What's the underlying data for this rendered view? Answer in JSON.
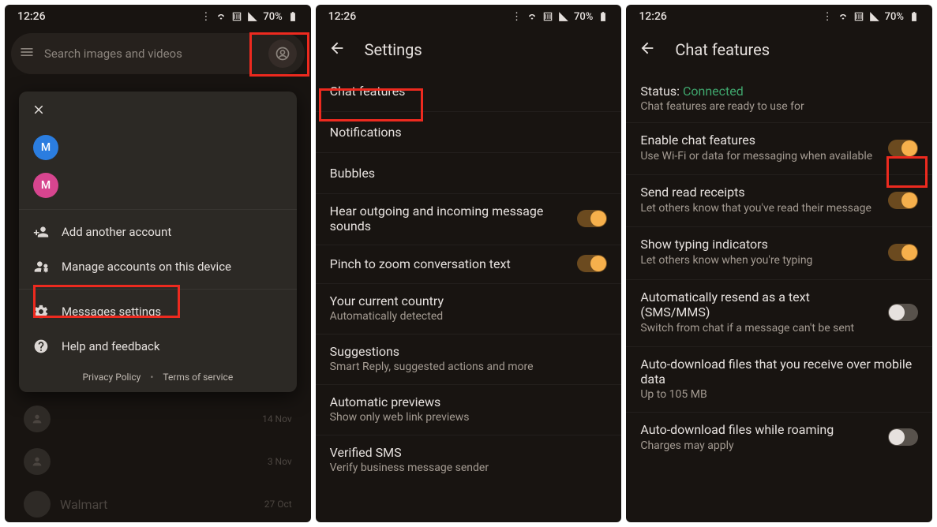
{
  "statusbar": {
    "time": "12:26",
    "battery": "70%"
  },
  "phone1": {
    "search_placeholder": "Search images and videos",
    "accounts": [
      {
        "letter": "M",
        "color": "#2b7de0"
      },
      {
        "letter": "M",
        "color": "#d7458f"
      }
    ],
    "menu": {
      "add_account": "Add another account",
      "manage_accounts": "Manage accounts on this device",
      "messages_settings": "Messages settings",
      "help_feedback": "Help and feedback"
    },
    "legal": {
      "privacy": "Privacy Policy",
      "terms": "Terms of service"
    },
    "bg_chats": [
      {
        "date": "14 Nov"
      },
      {
        "date": "3 Nov"
      },
      {
        "name": "Walmart",
        "date": "27 Oct"
      }
    ]
  },
  "phone2": {
    "title": "Settings",
    "items": [
      {
        "primary": "Chat features"
      },
      {
        "primary": "Notifications"
      },
      {
        "primary": "Bubbles"
      },
      {
        "primary": "Hear outgoing and incoming message sounds",
        "toggle": "on"
      },
      {
        "primary": "Pinch to zoom conversation text",
        "toggle": "on"
      },
      {
        "primary": "Your current country",
        "secondary": "Automatically detected"
      },
      {
        "primary": "Suggestions",
        "secondary": "Smart Reply, suggested actions and more"
      },
      {
        "primary": "Automatic previews",
        "secondary": "Show only web link previews"
      },
      {
        "primary": "Verified SMS",
        "secondary": "Verify business message sender"
      }
    ]
  },
  "phone3": {
    "title": "Chat features",
    "status_label": "Status: ",
    "status_value": "Connected",
    "status_sub": "Chat features are ready to use for",
    "items": [
      {
        "primary": "Enable chat features",
        "secondary": "Use Wi-Fi or data for messaging when available",
        "toggle": "on"
      },
      {
        "primary": "Send read receipts",
        "secondary": "Let others know that you've read their message",
        "toggle": "on"
      },
      {
        "primary": "Show typing indicators",
        "secondary": "Let others know when you're typing",
        "toggle": "on"
      },
      {
        "primary": "Automatically resend as a text (SMS/MMS)",
        "secondary": "Switch from chat if a message can't be sent",
        "toggle": "off"
      },
      {
        "primary": "Auto-download files that you receive over mobile data",
        "secondary": "Up to 105 MB"
      },
      {
        "primary": "Auto-download files while roaming",
        "secondary": "Charges may apply",
        "toggle": "off"
      }
    ]
  }
}
